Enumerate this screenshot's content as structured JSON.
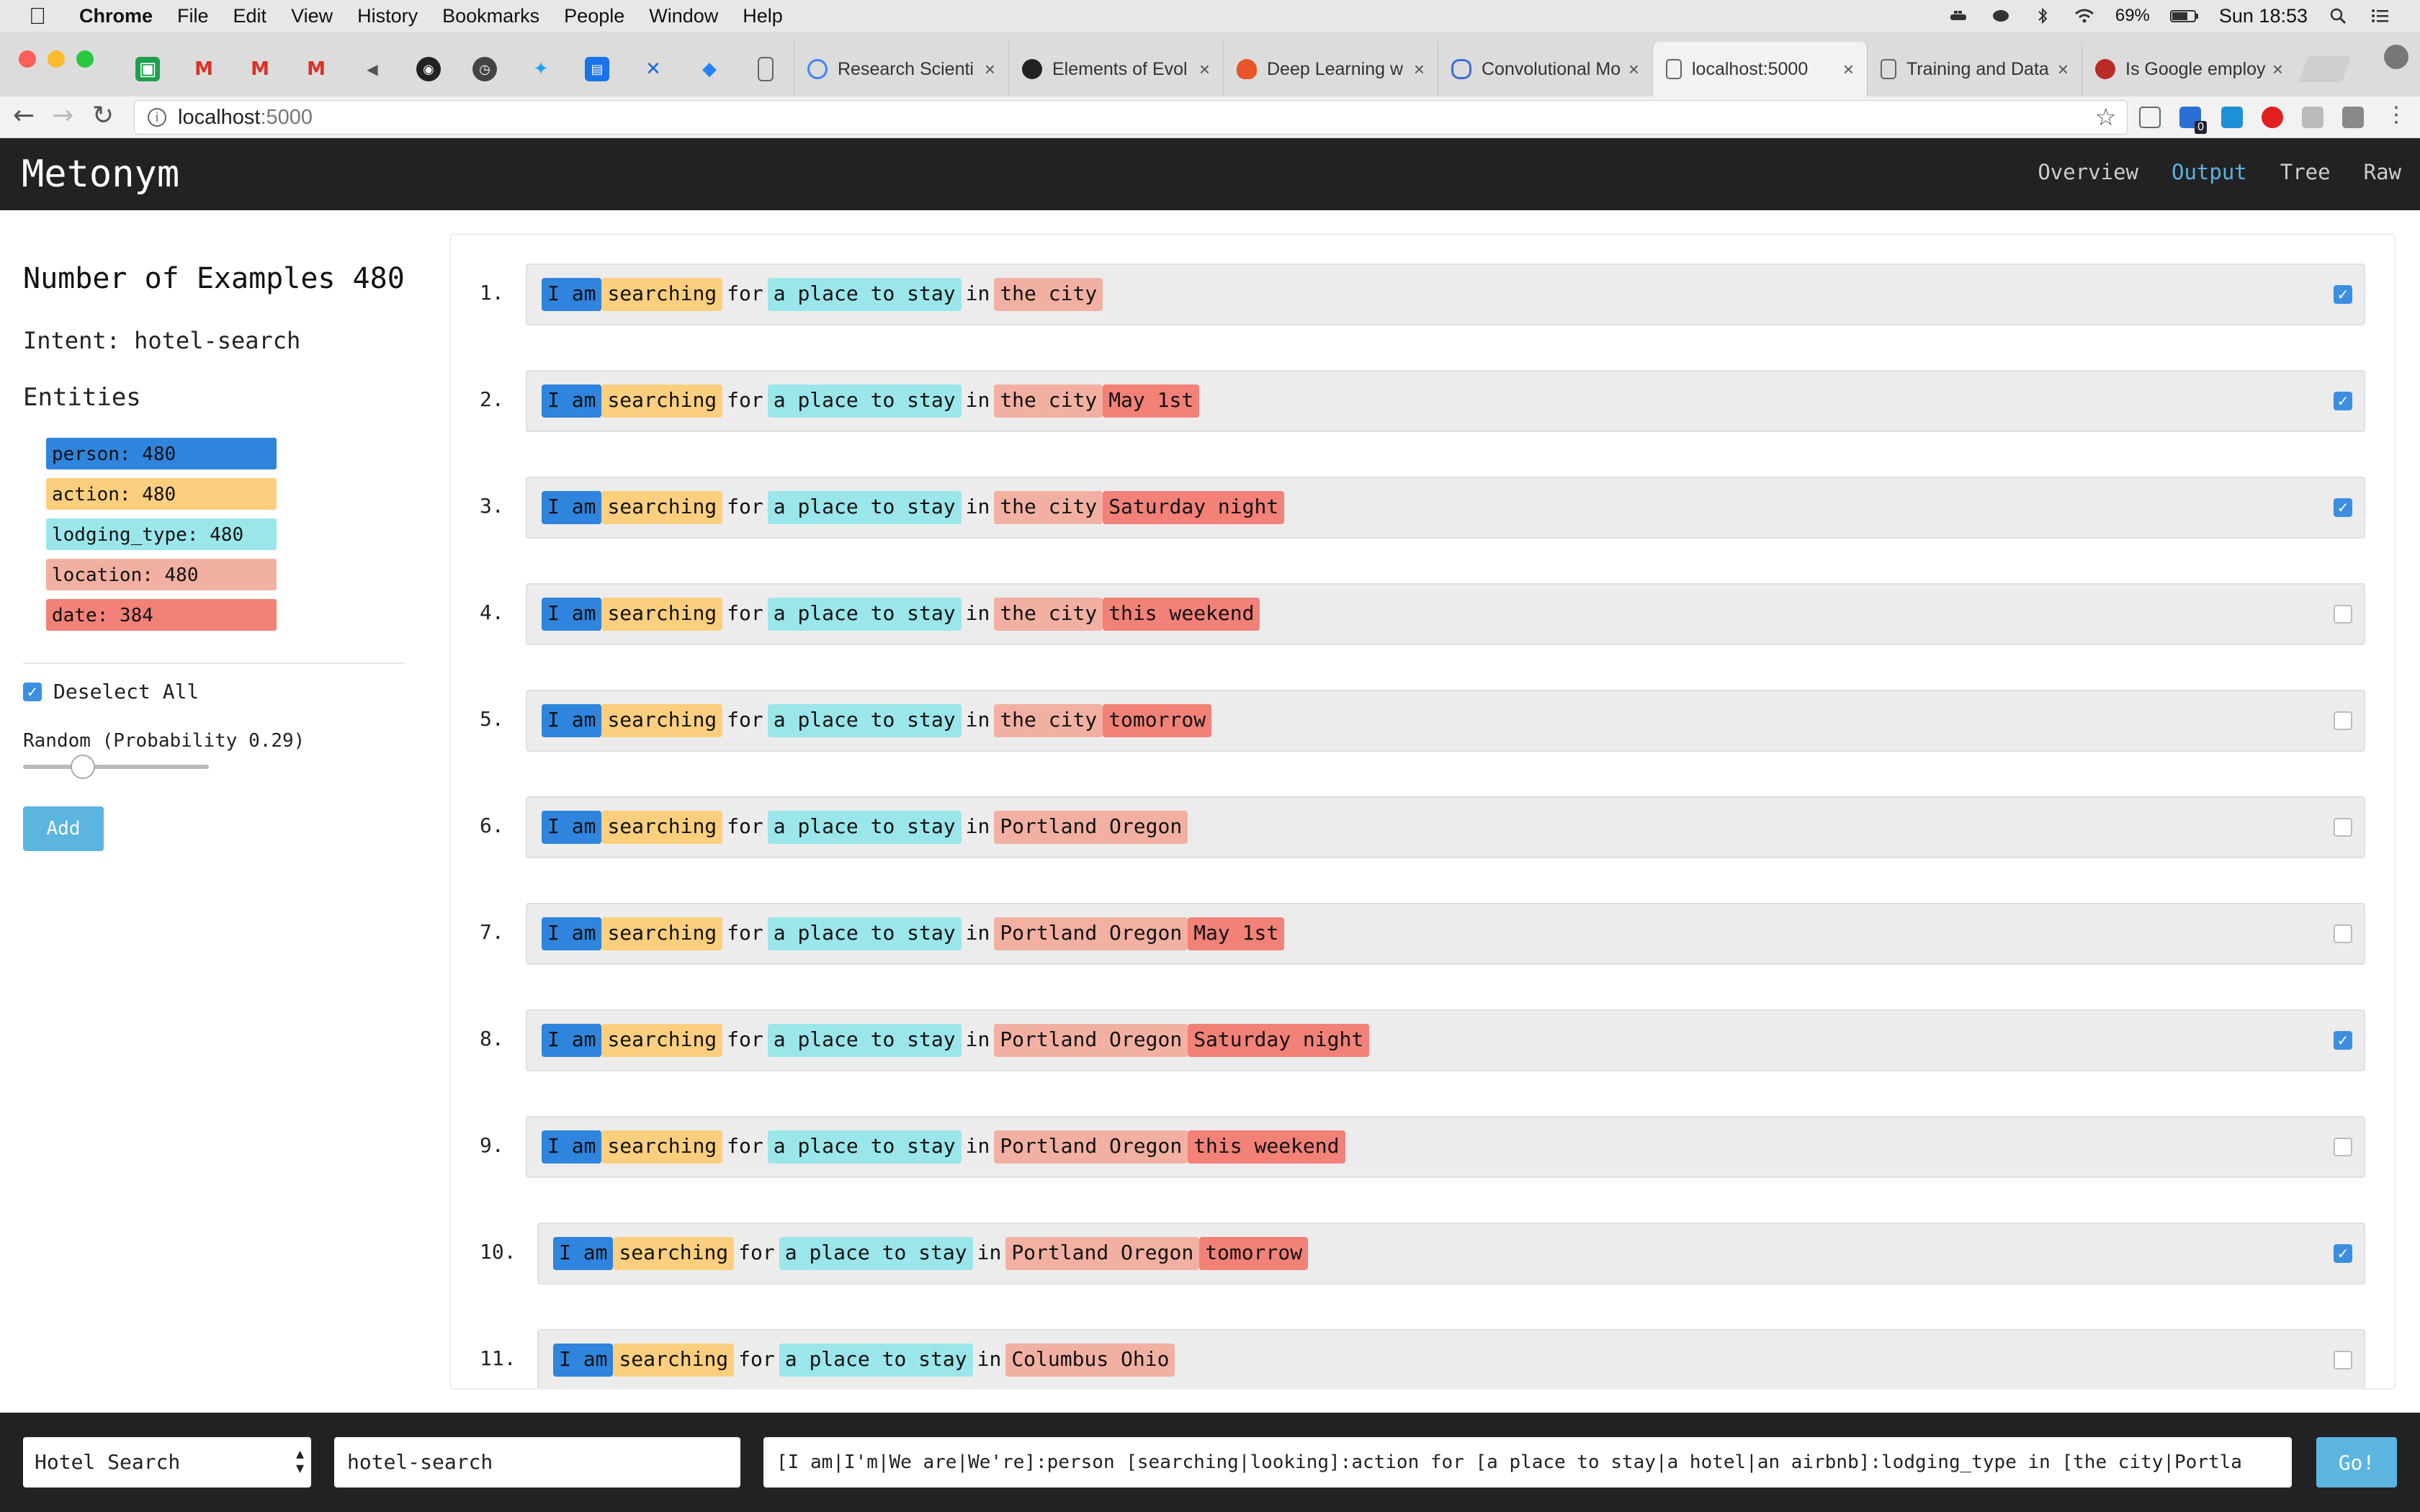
{
  "os_menubar": {
    "app_name": "Chrome",
    "menus": [
      "File",
      "Edit",
      "View",
      "History",
      "Bookmarks",
      "People",
      "Window",
      "Help"
    ],
    "battery": "69%",
    "clock": "Sun 18:53"
  },
  "browser": {
    "tabs": [
      {
        "title": "Research Scienti",
        "icon": "google-icon"
      },
      {
        "title": "Elements of Evol",
        "icon": "skull-icon"
      },
      {
        "title": "Deep Learning w",
        "icon": "flame-icon"
      },
      {
        "title": "Convolutional Mo",
        "icon": "link-icon"
      },
      {
        "title": "localhost:5000",
        "icon": "page-icon",
        "active": true
      },
      {
        "title": "Training and Data",
        "icon": "page-icon"
      },
      {
        "title": "Is Google employ",
        "icon": "quora-icon"
      }
    ],
    "address": "localhost",
    "address_port": ":5000",
    "extension_badge": "0"
  },
  "app": {
    "brand": "Metonym",
    "nav": [
      "Overview",
      "Output",
      "Tree",
      "Raw"
    ],
    "active_nav": "Output"
  },
  "sidebar": {
    "num_examples": "Number of Examples 480",
    "intent": "Intent: hotel-search",
    "entities_heading": "Entities",
    "entities": [
      {
        "label": "person: 480",
        "color": "#2f84dd"
      },
      {
        "label": "action: 480",
        "color": "#fccf7e"
      },
      {
        "label": "lodging_type: 480",
        "color": "#9ae6ea"
      },
      {
        "label": "location: 480",
        "color": "#f2b0a2"
      },
      {
        "label": "date: 384",
        "color": "#f28178"
      }
    ],
    "deselect_label": "Deselect All",
    "random_label": "Random (Probability 0.29)",
    "random_probability": 0.29,
    "add_label": "Add"
  },
  "examples": [
    {
      "num": "1.",
      "checked": true,
      "tokens": [
        {
          "t": "I am",
          "e": "person"
        },
        {
          "t": "searching",
          "e": "action"
        },
        {
          "t": "for",
          "e": null
        },
        {
          "t": "a place to stay",
          "e": "lodging"
        },
        {
          "t": "in",
          "e": null
        },
        {
          "t": "the city",
          "e": "location"
        }
      ]
    },
    {
      "num": "2.",
      "checked": true,
      "tokens": [
        {
          "t": "I am",
          "e": "person"
        },
        {
          "t": "searching",
          "e": "action"
        },
        {
          "t": "for",
          "e": null
        },
        {
          "t": "a place to stay",
          "e": "lodging"
        },
        {
          "t": "in",
          "e": null
        },
        {
          "t": "the city",
          "e": "location"
        },
        {
          "t": "May 1st",
          "e": "date"
        }
      ]
    },
    {
      "num": "3.",
      "checked": true,
      "tokens": [
        {
          "t": "I am",
          "e": "person"
        },
        {
          "t": "searching",
          "e": "action"
        },
        {
          "t": "for",
          "e": null
        },
        {
          "t": "a place to stay",
          "e": "lodging"
        },
        {
          "t": "in",
          "e": null
        },
        {
          "t": "the city",
          "e": "location"
        },
        {
          "t": "Saturday night",
          "e": "date"
        }
      ]
    },
    {
      "num": "4.",
      "checked": false,
      "tokens": [
        {
          "t": "I am",
          "e": "person"
        },
        {
          "t": "searching",
          "e": "action"
        },
        {
          "t": "for",
          "e": null
        },
        {
          "t": "a place to stay",
          "e": "lodging"
        },
        {
          "t": "in",
          "e": null
        },
        {
          "t": "the city",
          "e": "location"
        },
        {
          "t": "this weekend",
          "e": "date"
        }
      ]
    },
    {
      "num": "5.",
      "checked": false,
      "tokens": [
        {
          "t": "I am",
          "e": "person"
        },
        {
          "t": "searching",
          "e": "action"
        },
        {
          "t": "for",
          "e": null
        },
        {
          "t": "a place to stay",
          "e": "lodging"
        },
        {
          "t": "in",
          "e": null
        },
        {
          "t": "the city",
          "e": "location"
        },
        {
          "t": "tomorrow",
          "e": "date"
        }
      ]
    },
    {
      "num": "6.",
      "checked": false,
      "tokens": [
        {
          "t": "I am",
          "e": "person"
        },
        {
          "t": "searching",
          "e": "action"
        },
        {
          "t": "for",
          "e": null
        },
        {
          "t": "a place to stay",
          "e": "lodging"
        },
        {
          "t": "in",
          "e": null
        },
        {
          "t": "Portland Oregon",
          "e": "location"
        }
      ]
    },
    {
      "num": "7.",
      "checked": false,
      "tokens": [
        {
          "t": "I am",
          "e": "person"
        },
        {
          "t": "searching",
          "e": "action"
        },
        {
          "t": "for",
          "e": null
        },
        {
          "t": "a place to stay",
          "e": "lodging"
        },
        {
          "t": "in",
          "e": null
        },
        {
          "t": "Portland Oregon",
          "e": "location"
        },
        {
          "t": "May 1st",
          "e": "date"
        }
      ]
    },
    {
      "num": "8.",
      "checked": true,
      "tokens": [
        {
          "t": "I am",
          "e": "person"
        },
        {
          "t": "searching",
          "e": "action"
        },
        {
          "t": "for",
          "e": null
        },
        {
          "t": "a place to stay",
          "e": "lodging"
        },
        {
          "t": "in",
          "e": null
        },
        {
          "t": "Portland Oregon",
          "e": "location"
        },
        {
          "t": "Saturday night",
          "e": "date"
        }
      ]
    },
    {
      "num": "9.",
      "checked": false,
      "tokens": [
        {
          "t": "I am",
          "e": "person"
        },
        {
          "t": "searching",
          "e": "action"
        },
        {
          "t": "for",
          "e": null
        },
        {
          "t": "a place to stay",
          "e": "lodging"
        },
        {
          "t": "in",
          "e": null
        },
        {
          "t": "Portland Oregon",
          "e": "location"
        },
        {
          "t": "this weekend",
          "e": "date"
        }
      ]
    },
    {
      "num": "10.",
      "checked": true,
      "tokens": [
        {
          "t": "I am",
          "e": "person"
        },
        {
          "t": "searching",
          "e": "action"
        },
        {
          "t": "for",
          "e": null
        },
        {
          "t": "a place to stay",
          "e": "lodging"
        },
        {
          "t": "in",
          "e": null
        },
        {
          "t": "Portland Oregon",
          "e": "location"
        },
        {
          "t": "tomorrow",
          "e": "date"
        }
      ]
    },
    {
      "num": "11.",
      "checked": false,
      "tokens": [
        {
          "t": "I am",
          "e": "person"
        },
        {
          "t": "searching",
          "e": "action"
        },
        {
          "t": "for",
          "e": null
        },
        {
          "t": "a place to stay",
          "e": "lodging"
        },
        {
          "t": "in",
          "e": null
        },
        {
          "t": "Columbus Ohio",
          "e": "location"
        }
      ]
    }
  ],
  "footer": {
    "template_select": "Hotel Search",
    "intent_value": "hotel-search",
    "pattern_value": "[I am|I'm|We are|We're]:person [searching|looking]:action for [a place to stay|a hotel|an airbnb]:lodging_type in [the city|Portla",
    "go_label": "Go!"
  }
}
